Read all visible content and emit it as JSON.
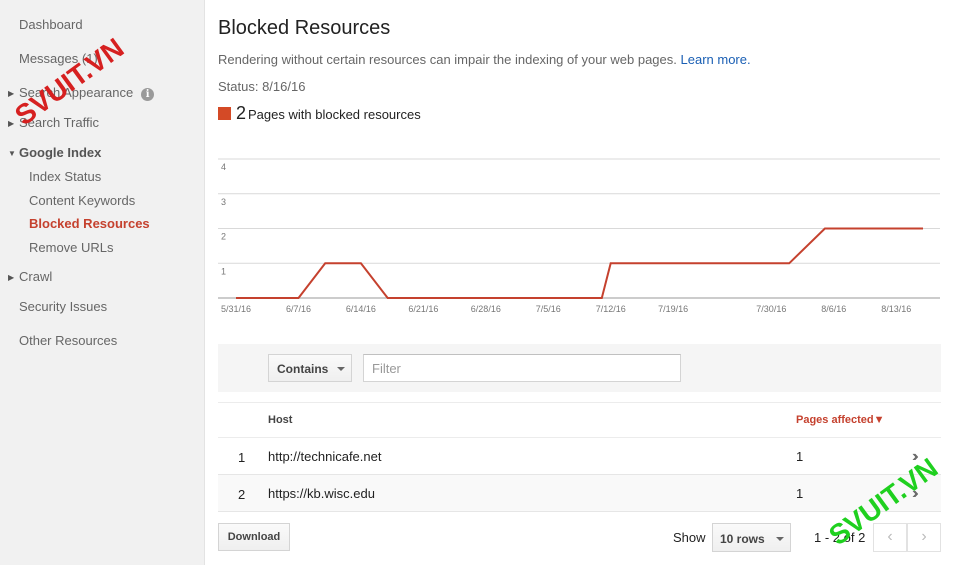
{
  "sidebar": {
    "items": [
      {
        "label": "Dashboard"
      },
      {
        "label": "Messages (1)"
      },
      {
        "label": "Search Appearance"
      },
      {
        "label": "Search Traffic"
      },
      {
        "label": "Google Index"
      },
      {
        "label": "Index Status"
      },
      {
        "label": "Content Keywords"
      },
      {
        "label": "Blocked Resources"
      },
      {
        "label": "Remove URLs"
      },
      {
        "label": "Crawl"
      },
      {
        "label": "Security Issues"
      },
      {
        "label": "Other Resources"
      }
    ],
    "info_icon": "i"
  },
  "header": {
    "title": "Blocked Resources",
    "description": "Rendering without certain resources can impair the indexing of your web pages.",
    "learn_more": "Learn more.",
    "status": "Status: 8/16/16"
  },
  "legend": {
    "count": "2",
    "label": "Pages with blocked resources",
    "color": "#d44a26"
  },
  "chart_data": {
    "type": "line",
    "x": [
      "5/31/16",
      "6/3/16",
      "6/7/16",
      "6/10/16",
      "6/12/16",
      "6/14/16",
      "6/17/16",
      "6/21/16",
      "6/28/16",
      "7/5/16",
      "7/9/16",
      "7/11/16",
      "7/12/16",
      "7/19/16",
      "7/26/16",
      "7/30/16",
      "8/1/16",
      "8/5/16",
      "8/6/16",
      "8/13/16",
      "8/16/16"
    ],
    "series": [
      {
        "values": [
          0,
          0,
          0,
          1,
          1,
          1,
          0,
          0,
          0,
          0,
          0,
          0,
          1,
          1,
          1,
          1,
          1,
          2,
          2,
          2,
          2
        ]
      }
    ],
    "x_ticks": [
      "5/31/16",
      "6/7/16",
      "6/14/16",
      "6/21/16",
      "6/28/16",
      "7/5/16",
      "7/12/16",
      "7/19/16",
      "7/30/16",
      "8/6/16",
      "8/13/16"
    ],
    "y_ticks": [
      "1",
      "2",
      "3",
      "4"
    ],
    "ylim": [
      0,
      4
    ],
    "line_color": "#c5412e",
    "grid": true
  },
  "filter": {
    "mode": "Contains",
    "placeholder": "Filter"
  },
  "table": {
    "columns": [
      "Host",
      "Pages affected▼"
    ],
    "rows": [
      {
        "num": "1",
        "host": "http://technicafe.net",
        "pages": "1"
      },
      {
        "num": "2",
        "host": "https://kb.wisc.edu",
        "pages": "1"
      }
    ]
  },
  "footer": {
    "download": "Download",
    "show": "Show",
    "rows": "10 rows",
    "range": "1 - 2 of 2",
    "prev": "‹",
    "next": "›"
  },
  "watermark": "SVUIT.VN"
}
